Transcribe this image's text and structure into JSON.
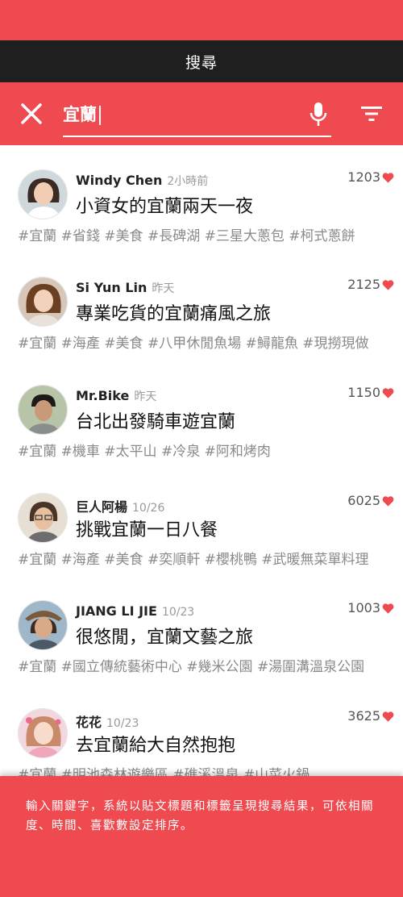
{
  "appbar": {
    "title": "搜尋"
  },
  "search": {
    "query": "宜蘭"
  },
  "colors": {
    "accent": "#ef4a4f",
    "appbar": "#1f1f1f",
    "heart": "#ef4a4f"
  },
  "icons": {
    "close": "close-icon",
    "mic": "mic-icon",
    "filter": "filter-icon",
    "like": "heart-icon"
  },
  "results": [
    {
      "author": "Windy Chen",
      "time": "2小時前",
      "title": "小資女的宜蘭兩天一夜",
      "likes": "1203",
      "tags": "#宜蘭 #省錢 #美食 #長碑湖 #三星大蔥包 #柯式蔥餅"
    },
    {
      "author": "Si Yun Lin",
      "time": "昨天",
      "title": "專業吃貨的宜蘭痛風之旅",
      "likes": "2125",
      "tags": "#宜蘭 #海產 #美食 #八甲休閒魚場 #鱘龍魚 #現撈現做"
    },
    {
      "author": "Mr.Bike",
      "time": "昨天",
      "title": "台北出發騎車遊宜蘭",
      "likes": "1150",
      "tags": "#宜蘭 #機車 #太平山 #冷泉 #阿和烤肉"
    },
    {
      "author": "巨人阿楊",
      "time": "10/26",
      "title": "挑戰宜蘭一日八餐",
      "likes": "6025",
      "tags": "#宜蘭 #海產 #美食 #奕順軒 #櫻桃鴨 #武暖無菜單料理"
    },
    {
      "author": "JIANG LI JIE",
      "time": "10/23",
      "title": "很悠閒，宜蘭文藝之旅",
      "likes": "1003",
      "tags": "#宜蘭 #國立傳統藝術中心 #幾米公園 #湯圍溝溫泉公園"
    },
    {
      "author": "花花",
      "time": "10/23",
      "title": "去宜蘭給大自然抱抱",
      "likes": "3625",
      "tags": "#宜蘭 #明池森林遊樂區 #礁溪溫泉 #山菜火鍋"
    }
  ],
  "footer": {
    "description": "輸入關鍵字，系統以貼文標題和標籤呈現搜尋結果，可依相關度、時間、喜歡數設定排序。"
  }
}
